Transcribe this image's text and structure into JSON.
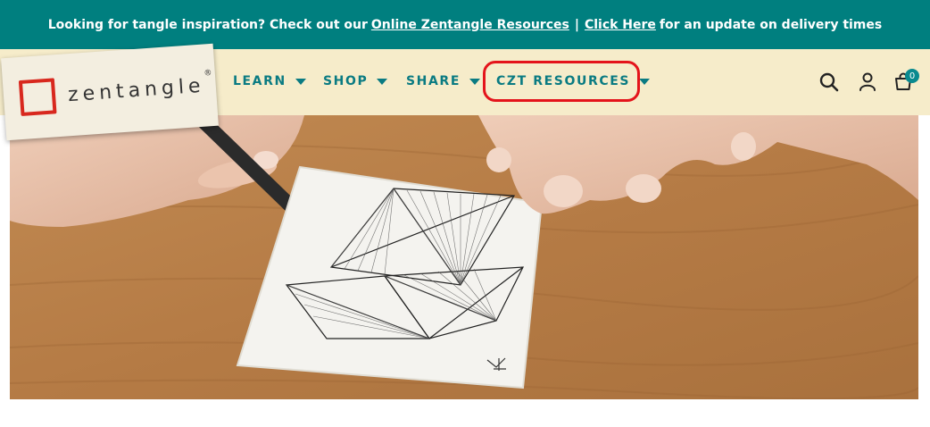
{
  "announcement": {
    "text_before": "Looking for tangle inspiration? Check out our",
    "link1": "Online Zentangle Resources",
    "separator": "|",
    "link2": "Click Here",
    "text_after": "for an update on delivery times"
  },
  "logo": {
    "text": "zentangle",
    "mark": "®"
  },
  "nav": {
    "items": [
      {
        "label": "LEARN"
      },
      {
        "label": "SHOP"
      },
      {
        "label": "SHARE"
      },
      {
        "label": "CZT RESOURCES"
      }
    ]
  },
  "icons": {
    "search": "search-icon",
    "account": "user-icon",
    "cart": "cart-icon"
  },
  "cart": {
    "count": "0"
  },
  "colors": {
    "announcement_bg": "#007f7f",
    "header_bg": "#f6ecca",
    "nav_text": "#0a7b82",
    "highlight": "#e4141b",
    "logo_red": "#d8281e"
  }
}
